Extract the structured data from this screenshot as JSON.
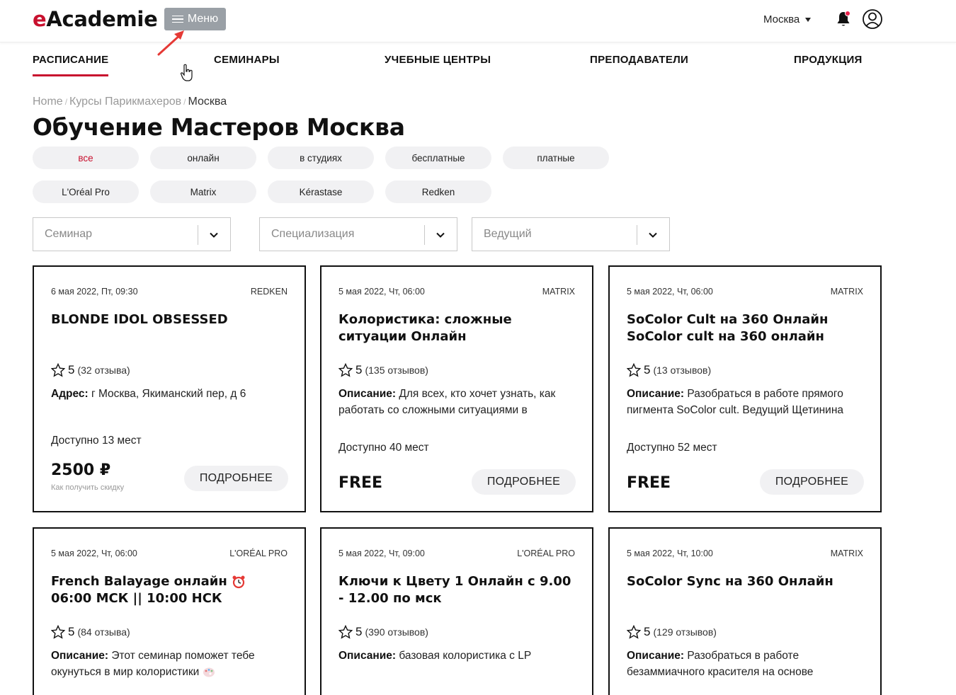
{
  "header": {
    "logo_e": "e",
    "logo_rest": "Academie",
    "menu_label": "Меню",
    "city": "Москва"
  },
  "nav": [
    {
      "label": "РАСПИСАНИЕ",
      "active": true
    },
    {
      "label": "СЕМИНАРЫ"
    },
    {
      "label": "УЧЕБНЫЕ ЦЕНТРЫ"
    },
    {
      "label": "ПРЕПОДАВАТЕЛИ"
    },
    {
      "label": "ПРОДУКЦИЯ"
    }
  ],
  "breadcrumb": {
    "home": "Home",
    "section": "Курсы Парикмахеров",
    "current": "Москва",
    "sep": "/"
  },
  "page_title": "Обучение Мастеров Москва",
  "filter_chips": [
    "все",
    "онлайн",
    "в студиях",
    "бесплатные",
    "платные"
  ],
  "brand_chips": [
    "L'Oréal Pro",
    "Matrix",
    "Kérastase",
    "Redken"
  ],
  "selects": [
    {
      "placeholder": "Семинар"
    },
    {
      "placeholder": "Специализация"
    },
    {
      "placeholder": "Ведущий"
    }
  ],
  "accent_color": "#c8102e",
  "cards": [
    {
      "date": "6 мая 2022, Пт, 09:30",
      "brand": "REDKEN",
      "title": "BLONDE IDOL OBSESSED",
      "rating": "5",
      "reviews": "(32 отзыва)",
      "desc_label": "Адрес:",
      "desc": " г Москва, Якиманский пер, д 6",
      "available": "Доступно 13 мест",
      "price": "2500 ₽",
      "discount": "Как получить скидку",
      "more": "ПОДРОБНЕЕ"
    },
    {
      "date": "5 мая 2022, Чт, 06:00",
      "brand": "MATRIX",
      "title": "Колористика: сложные ситуации Онлайн",
      "rating": "5",
      "reviews": "(135 отзывов)",
      "desc_label": "Описание:",
      "desc": " Для всех, кто хочет узнать, как работать со сложными ситуациями в",
      "available": "Доступно 40 мест",
      "price": "FREE",
      "more": "ПОДРОБНЕЕ"
    },
    {
      "date": "5 мая 2022, Чт, 06:00",
      "brand": "MATRIX",
      "title": "SoColor Cult на 360 Онлайн SoColor cult на 360 онлайн",
      "rating": "5",
      "reviews": "(13 отзывов)",
      "desc_label": "Описание:",
      "desc": " Разобраться в работе прямого пигмента SoColor cult. Ведущий Щетинина",
      "available": "Доступно 52 мест",
      "price": "FREE",
      "more": "ПОДРОБНЕЕ"
    },
    {
      "date": "5 мая 2022, Чт, 06:00",
      "brand": "L'ORÉAL PRO",
      "title_a": "French Balayage онлайн ",
      "title_b": " 06:00 МСК || 10:00 НСК",
      "rating": "5",
      "reviews": "(84 отзыва)",
      "desc_label": "Описание:",
      "desc": " Этот семинар поможет тебе окунуться в мир колористики "
    },
    {
      "date": "5 мая 2022, Чт, 09:00",
      "brand": "L'ORÉAL PRO",
      "title": "Ключи к Цвету 1 Онлайн с 9.00 - 12.00 по мск",
      "rating": "5",
      "reviews": "(390 отзывов)",
      "desc_label": "Описание:",
      "desc": " базовая колористика с LP"
    },
    {
      "date": "5 мая 2022, Чт, 10:00",
      "brand": "MATRIX",
      "title": "SoColor Sync на 360 Онлайн",
      "rating": "5",
      "reviews": "(129 отзывов)",
      "desc_label": "Описание:",
      "desc": " Разобраться в работе безаммиачного красителя на основе"
    }
  ]
}
